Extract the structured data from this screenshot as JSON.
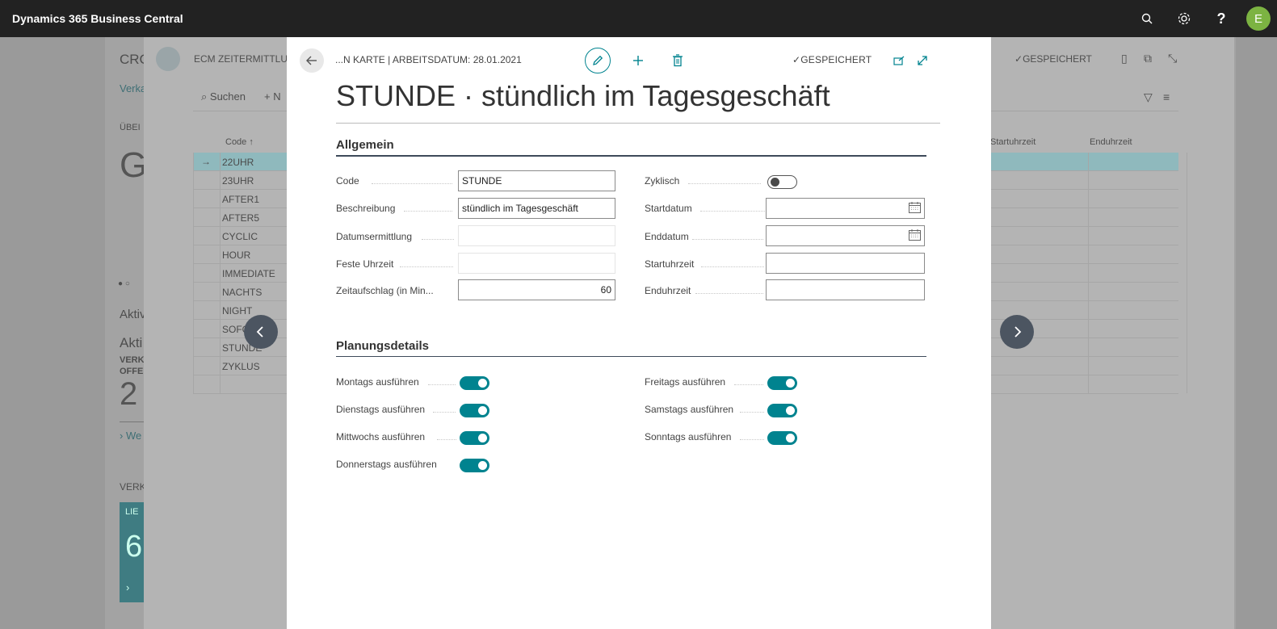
{
  "app": {
    "title": "Dynamics 365 Business Central",
    "user_initial": "E"
  },
  "background": {
    "role_title_partial": "CRC",
    "role_subtitle_partial": "Verka",
    "overview_partial": "ÜBEI",
    "big_partial": "G",
    "activities_partial": "Aktiv",
    "activities2_partial": "Akti",
    "sales_partial": "VERK",
    "open_partial": "OFFE",
    "count": "2",
    "more_partial": "We",
    "sales2_partial": "VERK",
    "tile_label_partial": "LIE",
    "tile_value_partial": "6",
    "list_title": "ECM ZEITERMITTLUN",
    "search_label": "Suchen",
    "new_partial": "+ N",
    "saved_label": "GESPEICHERT",
    "col_code": "Code ↑",
    "col_start": "Startuhrzeit",
    "col_end": "Enduhrzeit",
    "rows": [
      "22UHR",
      "23UHR",
      "AFTER1",
      "AFTER5",
      "CYCLIC",
      "HOUR",
      "IMMEDIATE",
      "NACHTS",
      "NIGHT",
      "SOFO",
      "STUNDE",
      "ZYKLUS"
    ]
  },
  "dialog": {
    "caption": "...N KARTE | ARBEITSDATUM: 28.01.2021",
    "saved_label": "GESPEICHERT",
    "title": "STUNDE · stündlich im Tagesgeschäft",
    "general": {
      "title": "Allgemein",
      "code_label": "Code",
      "code_value": "STUNDE",
      "description_label": "Beschreibung",
      "description_value": "stündlich im Tagesgeschäft",
      "date_calc_label": "Datumsermittlung",
      "date_calc_value": "",
      "fixed_time_label": "Feste Uhrzeit",
      "fixed_time_value": "",
      "surcharge_label": "Zeitaufschlag (in Min...",
      "surcharge_value": "60",
      "cyclic_label": "Zyklisch",
      "cyclic_on": false,
      "start_date_label": "Startdatum",
      "start_date_value": "",
      "end_date_label": "Enddatum",
      "end_date_value": "",
      "start_time_label": "Startuhrzeit",
      "start_time_value": "",
      "end_time_label": "Enduhrzeit",
      "end_time_value": ""
    },
    "planning": {
      "title": "Planungsdetails",
      "monday": {
        "label": "Montags ausführen",
        "on": true
      },
      "tuesday": {
        "label": "Dienstags ausführen",
        "on": true
      },
      "wednesday": {
        "label": "Mittwochs ausführen",
        "on": true
      },
      "thursday": {
        "label": "Donnerstags ausführen",
        "on": true
      },
      "friday": {
        "label": "Freitags ausführen",
        "on": true
      },
      "saturday": {
        "label": "Samstags ausführen",
        "on": true
      },
      "sunday": {
        "label": "Sonntags ausführen",
        "on": true
      }
    }
  },
  "colors": {
    "accent": "#00838f",
    "topbar": "#222222",
    "avatar": "#7cb342"
  }
}
